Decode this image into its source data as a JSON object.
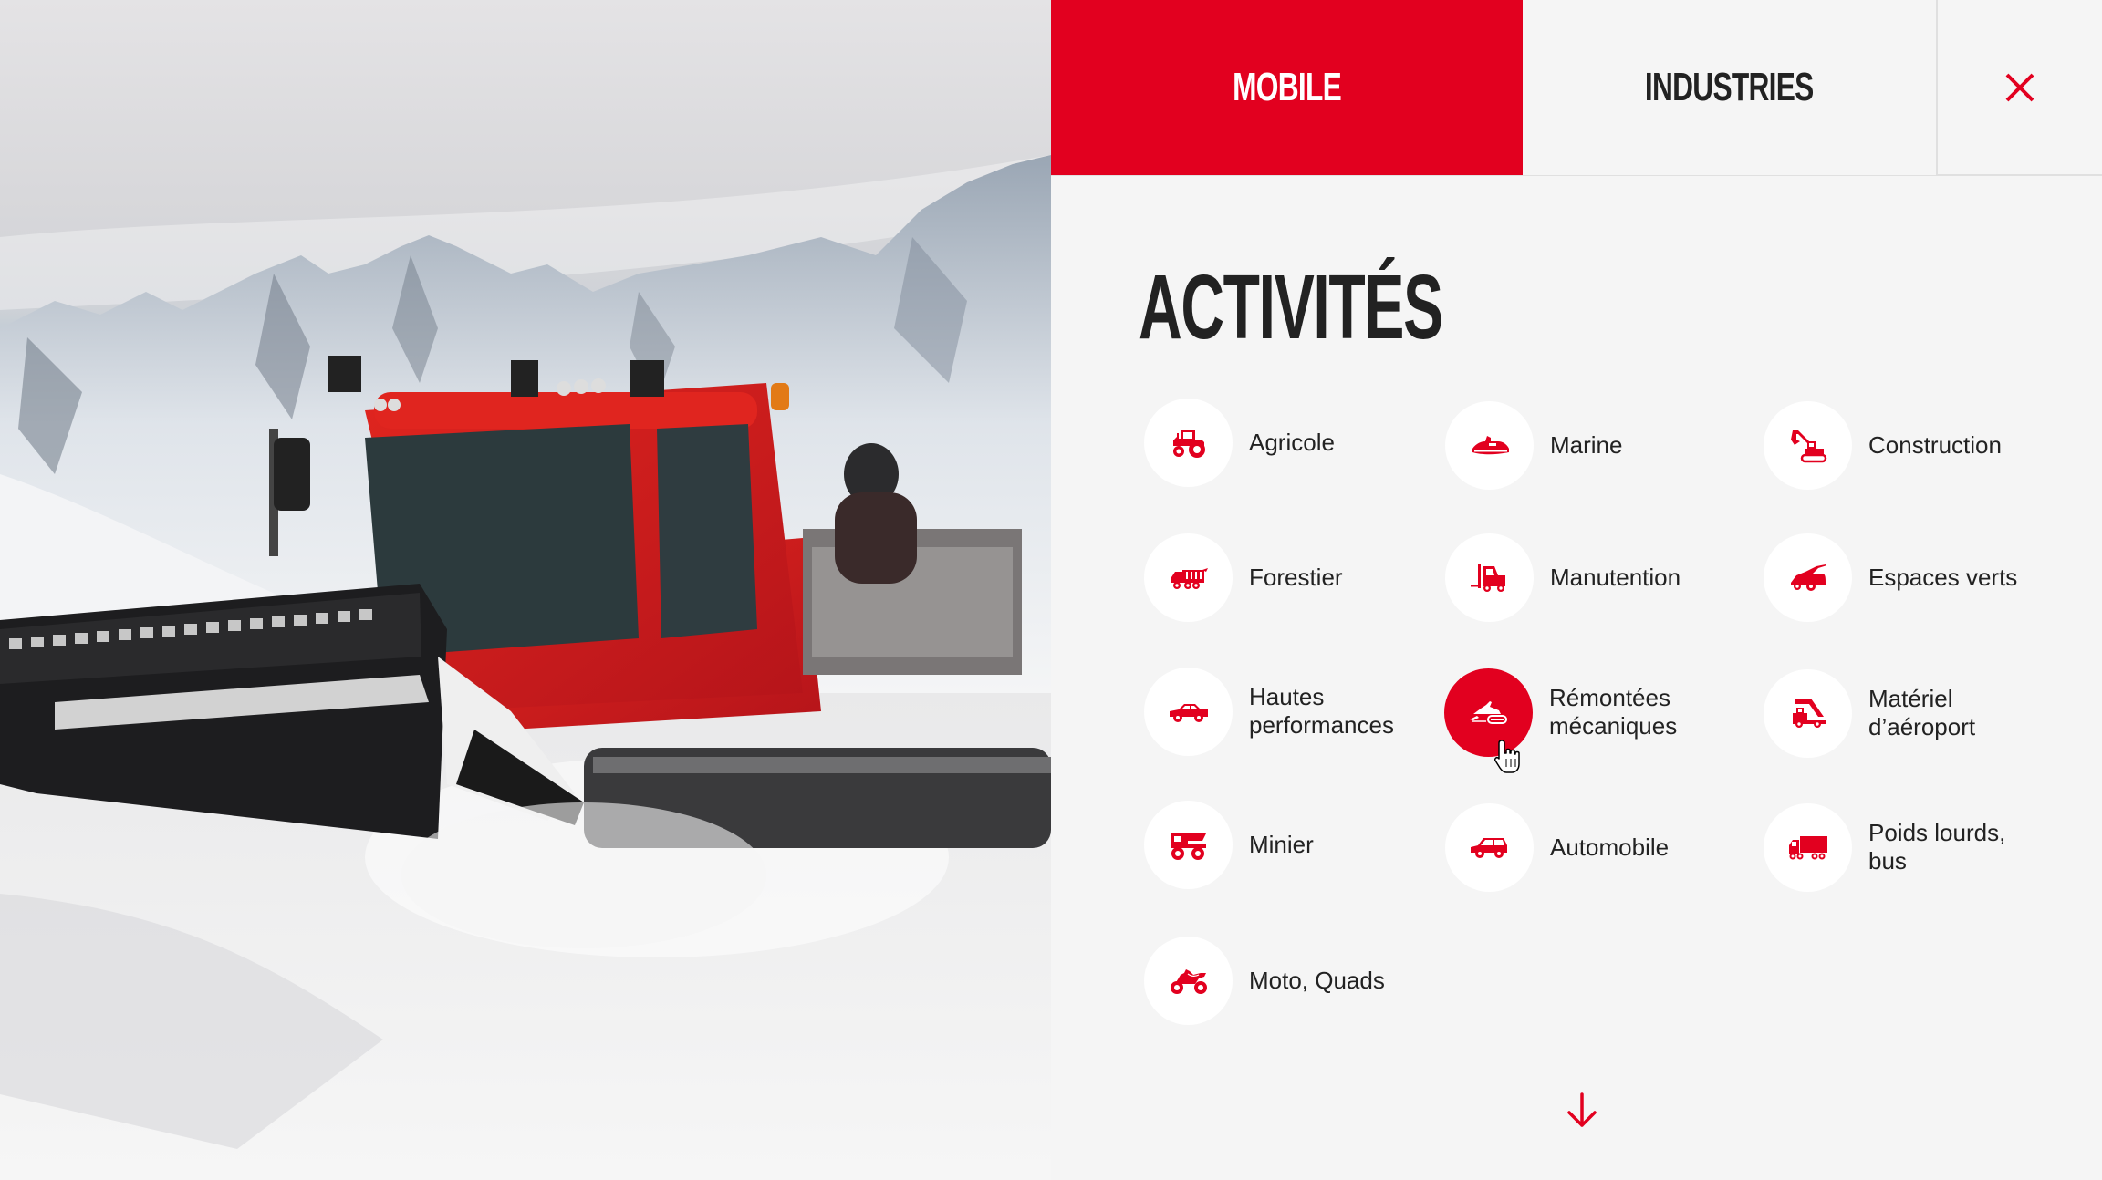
{
  "colors": {
    "brand_red": "#E2001F",
    "text_dark": "#222222",
    "panel_bg": "#F5F5F5",
    "circle_bg": "#FFFFFF"
  },
  "photo": {
    "subject": "red snow groomer on mountain slope",
    "icon": "photo-snowcat"
  },
  "header": {
    "tabs": [
      {
        "label": "MOBILE",
        "active": true
      },
      {
        "label": "INDUSTRIES",
        "active": false
      }
    ],
    "close_icon": "close-icon"
  },
  "section": {
    "title": "ACTIVITÉS"
  },
  "activities": [
    {
      "label": "Agricole",
      "icon": "tractor-icon"
    },
    {
      "label": "Marine",
      "icon": "jet-ski-icon"
    },
    {
      "label": "Construction",
      "icon": "excavator-icon"
    },
    {
      "label": "Forestier",
      "icon": "forestry-truck-icon"
    },
    {
      "label": "Manutention",
      "icon": "forklift-icon"
    },
    {
      "label": "Espaces verts",
      "icon": "lawn-mower-icon"
    },
    {
      "label": "Hautes\nperformances",
      "icon": "sports-car-icon"
    },
    {
      "label": "Rémontées\nmécaniques",
      "icon": "snowmobile-icon",
      "active": true
    },
    {
      "label": "Matériel\nd’aéroport",
      "icon": "airport-stairs-truck-icon"
    },
    {
      "label": "Minier",
      "icon": "mining-dump-truck-icon"
    },
    {
      "label": "Automobile",
      "icon": "car-icon"
    },
    {
      "label": "Poids lourds,\nbus",
      "icon": "truck-icon"
    },
    {
      "label": "Moto, Quads",
      "icon": "motorcycle-icon"
    }
  ],
  "scroll": {
    "icon": "arrow-down-icon"
  }
}
